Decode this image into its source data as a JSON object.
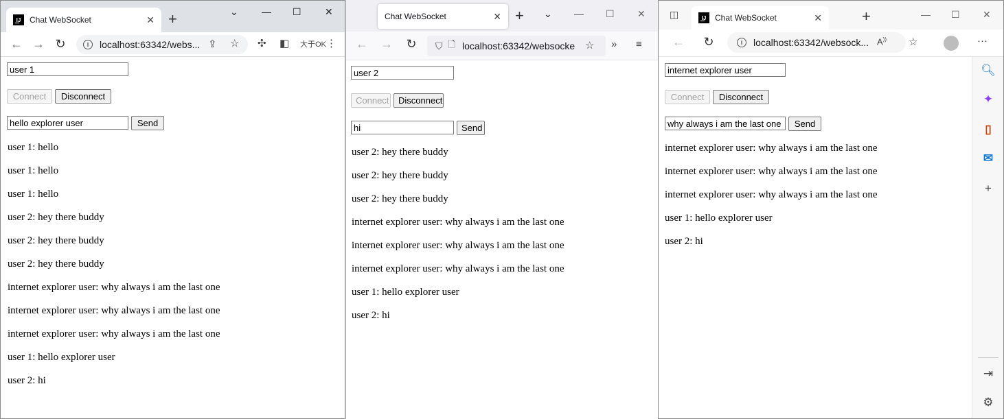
{
  "page_title": "Chat WebSocket",
  "windows": {
    "chrome": {
      "tab_title": "Chat WebSocket",
      "url": "localhost:63342/webs...",
      "ext_label": "大于OK",
      "username": "user 1",
      "message": "hello explorer user",
      "connect_label": "Connect",
      "disconnect_label": "Disconnect",
      "send_label": "Send",
      "messages": [
        "user 1: hello",
        "user 1: hello",
        "user 1: hello",
        "user 2: hey there buddy",
        "user 2: hey there buddy",
        "user 2: hey there buddy",
        "internet explorer user: why always i am the last one",
        "internet explorer user: why always i am the last one",
        "internet explorer user: why always i am the last one",
        "user 1: hello explorer user",
        "user 2: hi"
      ]
    },
    "firefox": {
      "tab_title": "Chat WebSocket",
      "url": "localhost:63342/websocke",
      "username": "user 2",
      "message": "hi",
      "connect_label": "Connect",
      "disconnect_label": "Disconnect",
      "send_label": "Send",
      "messages": [
        "user 2: hey there buddy",
        "user 2: hey there buddy",
        "user 2: hey there buddy",
        "internet explorer user: why always i am the last one",
        "internet explorer user: why always i am the last one",
        "internet explorer user: why always i am the last one",
        "user 1: hello explorer user",
        "user 2: hi"
      ]
    },
    "edge": {
      "tab_title": "Chat WebSocket",
      "url": "localhost:63342/websock...",
      "username": "internet explorer user",
      "message": "why always i am the last one",
      "connect_label": "Connect",
      "disconnect_label": "Disconnect",
      "send_label": "Send",
      "messages": [
        "internet explorer user: why always i am the last one",
        "internet explorer user: why always i am the last one",
        "internet explorer user: why always i am the last one",
        "user 1: hello explorer user",
        "user 2: hi"
      ]
    }
  },
  "colors": {
    "edge_search": "#0f6cbd",
    "edge_copilot": "#8b3dff",
    "edge_office": "#d83b01",
    "edge_outlook": "#0f78d4"
  }
}
